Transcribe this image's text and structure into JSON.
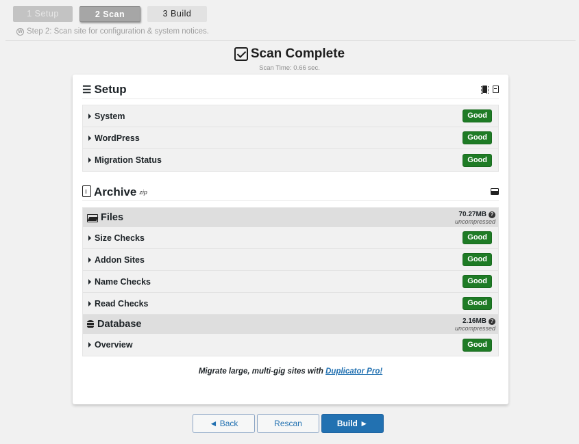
{
  "steps": [
    {
      "label": "1 Setup",
      "state": "done"
    },
    {
      "label": "2 Scan",
      "state": "active"
    },
    {
      "label": "3 Build",
      "state": "next"
    }
  ],
  "step_note": "Step 2: Scan site for configuration & system notices.",
  "header": {
    "title": "Scan Complete",
    "scan_time": "Scan Time: 0.66 sec."
  },
  "setup": {
    "title": "Setup",
    "items": [
      {
        "label": "System",
        "status": "Good"
      },
      {
        "label": "WordPress",
        "status": "Good"
      },
      {
        "label": "Migration Status",
        "status": "Good"
      }
    ]
  },
  "archive": {
    "title": "Archive",
    "format": "zip",
    "files": {
      "title": "Files",
      "size": "70.27MB",
      "size_note": "uncompressed",
      "items": [
        {
          "label": "Size Checks",
          "status": "Good"
        },
        {
          "label": "Addon Sites",
          "status": "Good"
        },
        {
          "label": "Name Checks",
          "status": "Good"
        },
        {
          "label": "Read Checks",
          "status": "Good"
        }
      ]
    },
    "database": {
      "title": "Database",
      "size": "2.16MB",
      "size_note": "uncompressed",
      "items": [
        {
          "label": "Overview",
          "status": "Good"
        }
      ]
    }
  },
  "promo": {
    "text": "Migrate large, multi-gig sites with ",
    "link": "Duplicator Pro!"
  },
  "footer": {
    "back": "◄ Back",
    "rescan": "Rescan",
    "build": "Build ►"
  },
  "colors": {
    "good": "#1e7b25",
    "primary": "#2271b1"
  }
}
